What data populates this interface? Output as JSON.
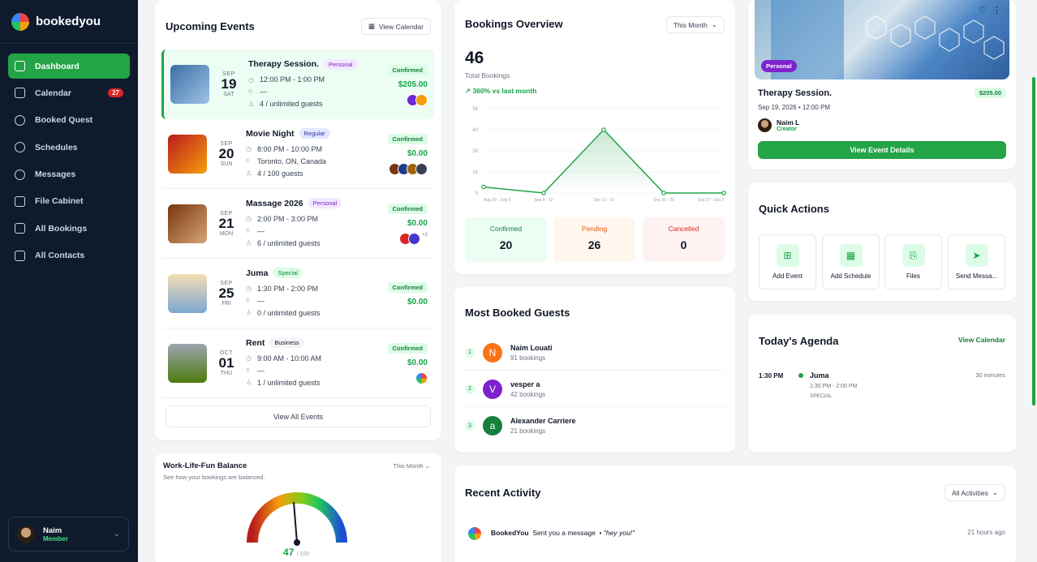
{
  "brand": {
    "name": "bookedyou"
  },
  "nav": [
    {
      "label": "Dashboard",
      "icon": "dashboard-icon",
      "active": true
    },
    {
      "label": "Calendar",
      "icon": "calendar-icon",
      "badge": "27"
    },
    {
      "label": "Booked Quest",
      "icon": "compass-icon"
    },
    {
      "label": "Schedules",
      "icon": "clock-icon"
    },
    {
      "label": "Messages",
      "icon": "chat-icon"
    },
    {
      "label": "File Cabinet",
      "icon": "file-icon"
    },
    {
      "label": "All Bookings",
      "icon": "bookings-icon"
    },
    {
      "label": "All Contacts",
      "icon": "contacts-icon"
    }
  ],
  "user": {
    "name": "Naim",
    "role": "Member"
  },
  "events": {
    "title": "Upcoming Events",
    "view_calendar": "View Calendar",
    "view_all": "View All Events",
    "items": [
      {
        "mon": "SEP",
        "day": "19",
        "dow": "SAT",
        "title": "Therapy Session.",
        "tag": "Personal",
        "time": "12:00 PM - 1:00 PM",
        "location": "—",
        "guests": "4 / unlimited guests",
        "status": "Confirmed",
        "price": "$205.00"
      },
      {
        "mon": "SEP",
        "day": "20",
        "dow": "SUN",
        "title": "Movie Night",
        "tag": "Regular",
        "time": "8:00 PM - 10:00 PM",
        "location": "Toronto, ON, Canada",
        "guests": "4 / 100 guests",
        "status": "Confirmed",
        "price": "$0.00"
      },
      {
        "mon": "SEP",
        "day": "21",
        "dow": "MON",
        "title": "Massage 2026",
        "tag": "Personal",
        "time": "2:00 PM - 3:00 PM",
        "location": "—",
        "guests": "6 / unlimited guests",
        "status": "Confirmed",
        "price": "$0.00",
        "more": "+2"
      },
      {
        "mon": "SEP",
        "day": "25",
        "dow": "FRI",
        "title": "Juma",
        "tag": "Special",
        "time": "1:30 PM - 2:00 PM",
        "location": "—",
        "guests": "0 / unlimited guests",
        "status": "Confirmed",
        "price": "$0.00"
      },
      {
        "mon": "OCT",
        "day": "01",
        "dow": "THU",
        "title": "Rent",
        "tag": "Business",
        "time": "9:00 AM - 10:00 AM",
        "location": "—",
        "guests": "1 / unlimited guests",
        "status": "Confirmed",
        "price": "$0.00"
      }
    ]
  },
  "wlf": {
    "title": "Work-Life-Fun Balance",
    "subtitle": "See how your bookings are balanced.",
    "period": "This Month",
    "score": "47",
    "max": "/ 100"
  },
  "overview": {
    "title": "Bookings Overview",
    "period": "This Month",
    "total": "46",
    "total_label": "Total Bookings",
    "trend": "360% vs last month",
    "confirmed_label": "Confirmed",
    "confirmed": "20",
    "pending_label": "Pending",
    "pending": "26",
    "cancelled_label": "Cancelled",
    "cancelled": "0"
  },
  "chart_data": {
    "type": "area",
    "categories": [
      "Aug 30 - Sep 5",
      "Sep 6 - 12",
      "Sep 13 - 19",
      "Sep 20 - 26",
      "Sep 27 - Oct 3"
    ],
    "values": [
      4,
      0,
      42,
      0,
      0
    ],
    "yticks": [
      "56",
      "42",
      "28",
      "14",
      "0"
    ],
    "ylim": [
      0,
      56
    ],
    "color": "#22a447"
  },
  "guests": {
    "title": "Most Booked Guests",
    "items": [
      {
        "rank": "1",
        "initial": "N",
        "name": "Naim Louati",
        "count": "91 bookings",
        "color": "#f97316"
      },
      {
        "rank": "2",
        "initial": "V",
        "name": "vesper a",
        "count": "42 bookings",
        "color": "#7e22ce"
      },
      {
        "rank": "3",
        "initial": "a",
        "name": "Alexander Carriere",
        "count": "21 bookings",
        "color": "#15803d"
      }
    ]
  },
  "featured": {
    "tag": "Personal",
    "title": "Therapy Session.",
    "price": "$205.00",
    "datetime": "Sep 19, 2026 • 12:00 PM",
    "creator": "Naim L",
    "creator_role": "Creator",
    "button": "View Event Details"
  },
  "quick": {
    "title": "Quick Actions",
    "items": [
      "Add Event",
      "Add Schedule",
      "Files",
      "Send Messa..."
    ]
  },
  "agenda": {
    "title": "Today's Agenda",
    "link": "View Calendar",
    "time": "1:30 PM",
    "event": "Juma",
    "range": "1:30 PM - 2:00 PM",
    "tag": "SPECIAL",
    "duration": "30 minutes"
  },
  "activity": {
    "title": "Recent Activity",
    "filter": "All Activities",
    "sender": "BookedYou",
    "action": "Sent you a message",
    "quote": "\"hey you!\"",
    "when": "21 hours ago"
  }
}
